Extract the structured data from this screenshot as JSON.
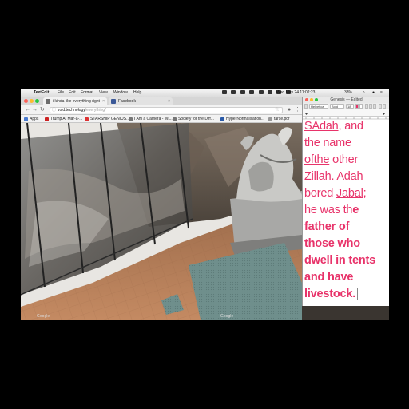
{
  "menubar": {
    "app_name": "TextEdit",
    "menus": [
      "File",
      "Edit",
      "Format",
      "View",
      "Window",
      "Help"
    ],
    "battery": "38%",
    "clock": "Wed May 24  11:02:23"
  },
  "browser": {
    "tabs": [
      {
        "label": "i kinda like everything right",
        "favicon_color": "#6d6d6d",
        "active": true
      },
      {
        "label": "Facebook",
        "favicon_color": "#3b5998",
        "active": false
      }
    ],
    "url_host": "void.technology",
    "url_path": "/everything/",
    "bookmarks": [
      {
        "label": "Apps",
        "color": "#4a7bd0"
      },
      {
        "label": "Trump At Mar-a-...",
        "color": "#c22"
      },
      {
        "label": "STARSHIP GENIUS...",
        "color": "#d33"
      },
      {
        "label": "I Am a Camera - Wi...",
        "color": "#777"
      },
      {
        "label": "Society for the Diff...",
        "color": "#777"
      },
      {
        "label": "HyperNormalisation...",
        "color": "#2a5aa8"
      },
      {
        "label": "tarse.pdf",
        "color": "#999"
      }
    ],
    "viewport_labels": [
      "Google",
      "Google"
    ]
  },
  "textedit": {
    "window_title": "Genesis — Edited",
    "font_family_popup": "Helvetica",
    "font_style_popup": "Bold",
    "font_size_popup": "18",
    "text_color": "#e8336a",
    "line1a": "SAdah",
    "line1b": ", and",
    "line2": "the name",
    "line3a": "ofthe",
    "line3b": " other",
    "line4a": "Zillah. ",
    "line4b": "Adah",
    "line5a": "bored ",
    "line5b": "Jabal",
    "line5c": ";",
    "line6a": "he was th",
    "line6b": "e",
    "line7": "father of",
    "line8": "those who",
    "line9": "dwell in tents",
    "line10": "and have",
    "line11": "livestock."
  }
}
